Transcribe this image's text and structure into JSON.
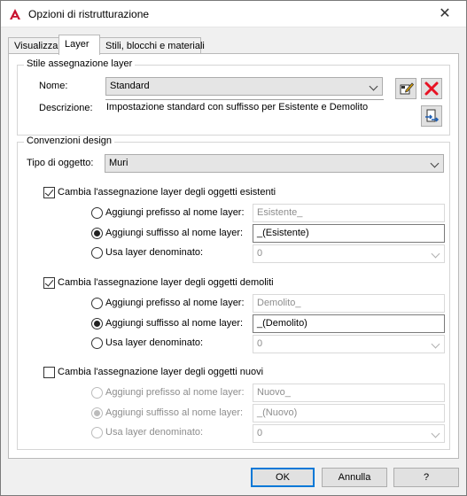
{
  "window": {
    "title": "Opzioni di ristrutturazione",
    "close_glyph": "✕"
  },
  "tabs": [
    "Visualizza",
    "Layer",
    "Stili, blocchi e materiali"
  ],
  "layer_style": {
    "group_title": "Stile assegnazione layer",
    "name_label": "Nome:",
    "name_value": "Standard",
    "description_label": "Descrizione:",
    "description_value": "Impostazione standard con suffisso per Esistente e Demolito",
    "icons": [
      "edit-style-icon",
      "delete-icon",
      "import-export-icon"
    ]
  },
  "design": {
    "group_title": "Convenzioni design",
    "object_type_label": "Tipo di oggetto:",
    "object_type_value": "Muri",
    "sections": [
      {
        "checkbox_label": "Cambia l'assegnazione layer degli oggetti esistenti",
        "checked": true,
        "enabled": true,
        "prefix_label": "Aggiungi prefisso al nome layer:",
        "prefix_value": "Esistente_",
        "suffix_label": "Aggiungi suffisso al nome layer:",
        "suffix_value": "_(Esistente)",
        "named_label": "Usa layer denominato:",
        "named_value": "0",
        "selected": "suffix"
      },
      {
        "checkbox_label": "Cambia l'assegnazione layer degli oggetti demoliti",
        "checked": true,
        "enabled": true,
        "prefix_label": "Aggiungi prefisso al nome layer:",
        "prefix_value": "Demolito_",
        "suffix_label": "Aggiungi suffisso al nome layer:",
        "suffix_value": "_(Demolito)",
        "named_label": "Usa layer denominato:",
        "named_value": "0",
        "selected": "suffix"
      },
      {
        "checkbox_label": "Cambia l'assegnazione layer degli oggetti nuovi",
        "checked": false,
        "enabled": false,
        "prefix_label": "Aggiungi prefisso al nome layer:",
        "prefix_value": "Nuovo_",
        "suffix_label": "Aggiungi suffisso al nome layer:",
        "suffix_value": "_(Nuovo)",
        "named_label": "Usa layer denominato:",
        "named_value": "0",
        "selected": "suffix"
      }
    ]
  },
  "buttons": {
    "ok": "OK",
    "cancel": "Annulla",
    "help": "?"
  },
  "colors": {
    "accent": "#0078d7",
    "delete_red": "#e81123",
    "app_red": "#c8102e"
  }
}
